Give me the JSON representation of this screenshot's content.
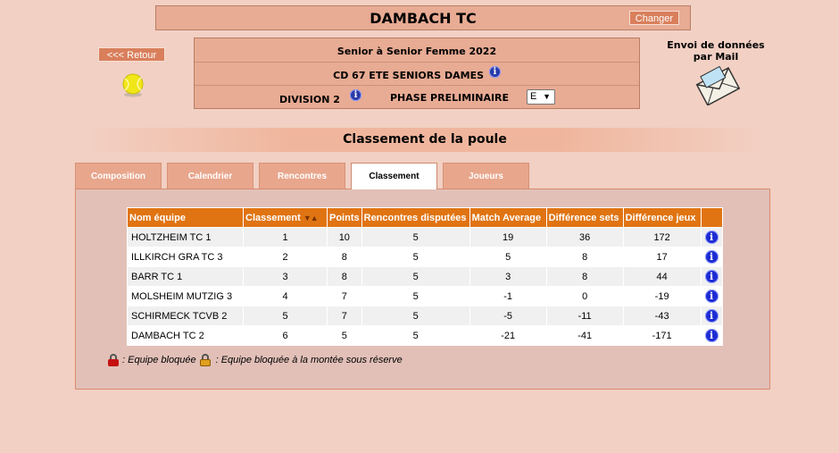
{
  "header": {
    "club_name": "DAMBACH TC",
    "change_label": "Changer"
  },
  "back_label": "<<< Retour",
  "competition": {
    "title": "Senior  à Senior  Femme  2022",
    "championship": "CD 67 ETE SENIORS DAMES",
    "division": "DIVISION 2",
    "phase_label": "PHASE PRELIMINAIRE",
    "phase_value": "E"
  },
  "mail": {
    "line1": "Envoi de données",
    "line2": "par Mail"
  },
  "pool_title": "Classement de la poule",
  "tabs": [
    {
      "label": "Composition",
      "active": false
    },
    {
      "label": "Calendrier",
      "active": false
    },
    {
      "label": "Rencontres",
      "active": false
    },
    {
      "label": "Classement",
      "active": true
    },
    {
      "label": "Joueurs",
      "active": false
    }
  ],
  "table": {
    "headers": [
      "Nom équipe",
      "Classement",
      "Points",
      "Rencontres disputées",
      "Match Average",
      "Différence sets",
      "Différence jeux",
      ""
    ],
    "rows": [
      {
        "team": "HOLTZHEIM TC 1",
        "rank": "1",
        "points": "10",
        "played": "5",
        "match_avg": "19",
        "diff_sets": "36",
        "diff_games": "172"
      },
      {
        "team": "ILLKIRCH GRA TC 3",
        "rank": "2",
        "points": "8",
        "played": "5",
        "match_avg": "5",
        "diff_sets": "8",
        "diff_games": "17"
      },
      {
        "team": "BARR TC 1",
        "rank": "3",
        "points": "8",
        "played": "5",
        "match_avg": "3",
        "diff_sets": "8",
        "diff_games": "44"
      },
      {
        "team": "MOLSHEIM MUTZIG 3",
        "rank": "4",
        "points": "7",
        "played": "5",
        "match_avg": "-1",
        "diff_sets": "0",
        "diff_games": "-19"
      },
      {
        "team": "SCHIRMECK TCVB 2",
        "rank": "5",
        "points": "7",
        "played": "5",
        "match_avg": "-5",
        "diff_sets": "-11",
        "diff_games": "-43"
      },
      {
        "team": "DAMBACH TC 2",
        "rank": "6",
        "points": "5",
        "played": "5",
        "match_avg": "-21",
        "diff_sets": "-41",
        "diff_games": "-171"
      }
    ]
  },
  "legend": {
    "blocked": ": Equipe bloquée",
    "blocked_promotion": ": Equipe bloquée à la montée sous réserve"
  },
  "colors": {
    "background": "#f2d0c3",
    "accent": "#e8ab93",
    "table_header": "#e07412",
    "button": "#d97f5c",
    "info_icon": "#1d2bd4"
  }
}
